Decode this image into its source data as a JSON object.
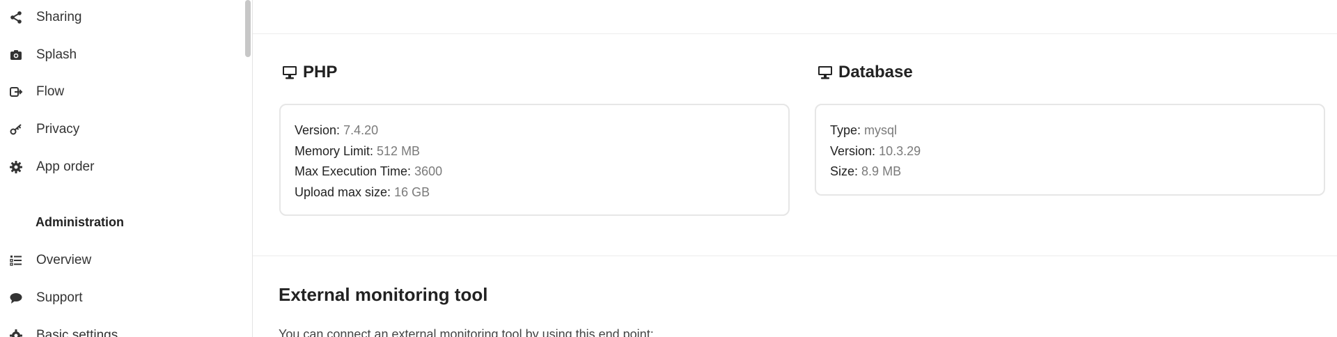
{
  "sidebar": {
    "items": [
      {
        "label": "Sharing",
        "icon": "share-icon"
      },
      {
        "label": "Splash",
        "icon": "camera-icon"
      },
      {
        "label": "Flow",
        "icon": "flow-icon"
      },
      {
        "label": "Privacy",
        "icon": "key-icon"
      },
      {
        "label": "App order",
        "icon": "gear-icon"
      }
    ],
    "admin_heading": "Administration",
    "admin_items": [
      {
        "label": "Overview",
        "icon": "list-icon"
      },
      {
        "label": "Support",
        "icon": "chat-bubble-icon"
      },
      {
        "label": "Basic settings",
        "icon": "gear-icon"
      }
    ]
  },
  "php": {
    "title": "PHP",
    "icon": "monitor-icon",
    "rows": [
      {
        "key": "Version:",
        "value": "7.4.20"
      },
      {
        "key": "Memory Limit:",
        "value": "512 MB"
      },
      {
        "key": "Max Execution Time:",
        "value": "3600"
      },
      {
        "key": "Upload max size:",
        "value": "16 GB"
      }
    ]
  },
  "database": {
    "title": "Database",
    "icon": "monitor-icon",
    "rows": [
      {
        "key": "Type:",
        "value": "mysql"
      },
      {
        "key": "Version:",
        "value": "10.3.29"
      },
      {
        "key": "Size:",
        "value": "8.9 MB"
      }
    ]
  },
  "monitoring": {
    "title": "External monitoring tool",
    "description": "You can connect an external monitoring tool by using this end point:"
  },
  "colors": {
    "text": "#222222",
    "muted": "#7a7a7a",
    "border": "#e6e6e6"
  }
}
